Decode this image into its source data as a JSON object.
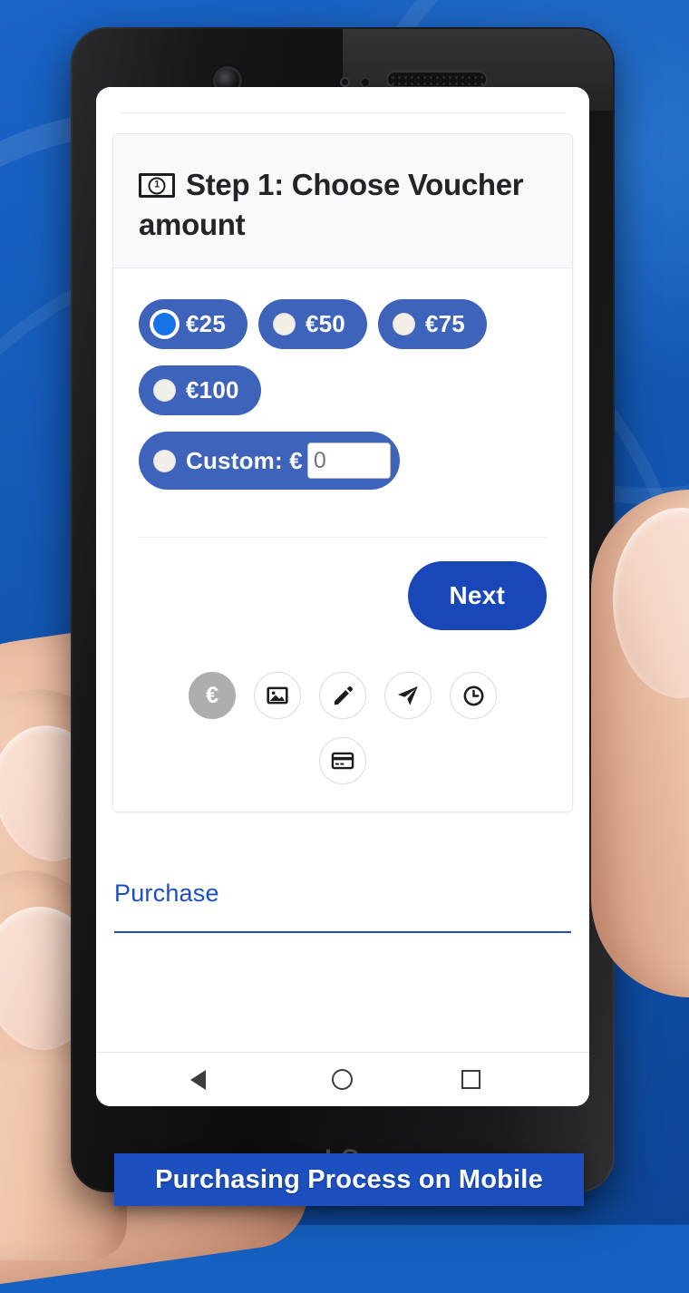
{
  "caption": {
    "text": "Purchasing Process on Mobile"
  },
  "device": {
    "brand": "LG"
  },
  "card": {
    "title": "Step 1: Choose Voucher amount",
    "title_icon": "banknote-icon",
    "coin_digit": "1"
  },
  "options": [
    {
      "label": "€25",
      "selected": true
    },
    {
      "label": "€50",
      "selected": false
    },
    {
      "label": "€75",
      "selected": false
    },
    {
      "label": "€100",
      "selected": false
    }
  ],
  "custom_option": {
    "label": "Custom: €",
    "value": "0",
    "placeholder": "0",
    "selected": false
  },
  "next_button": {
    "label": "Next"
  },
  "steps": [
    {
      "name": "euro-icon",
      "active": true,
      "glyph": "€"
    },
    {
      "name": "image-icon",
      "active": false
    },
    {
      "name": "pencil-icon",
      "active": false
    },
    {
      "name": "paper-plane-icon",
      "active": false
    },
    {
      "name": "clock-icon",
      "active": false
    },
    {
      "name": "credit-card-icon",
      "active": false
    }
  ],
  "footer": {
    "purchase_link": "Purchase"
  },
  "navbar": {
    "back": "back-button",
    "home": "home-button",
    "recents": "recents-button"
  },
  "colors": {
    "pill": "#3e63bb",
    "radio_selected": "#1474e8",
    "next_button": "#1a47b8",
    "link": "#1d4fc4",
    "caption_bg": "#1c4fc0",
    "background": "#1560c0",
    "step_active": "#aeaeae"
  }
}
